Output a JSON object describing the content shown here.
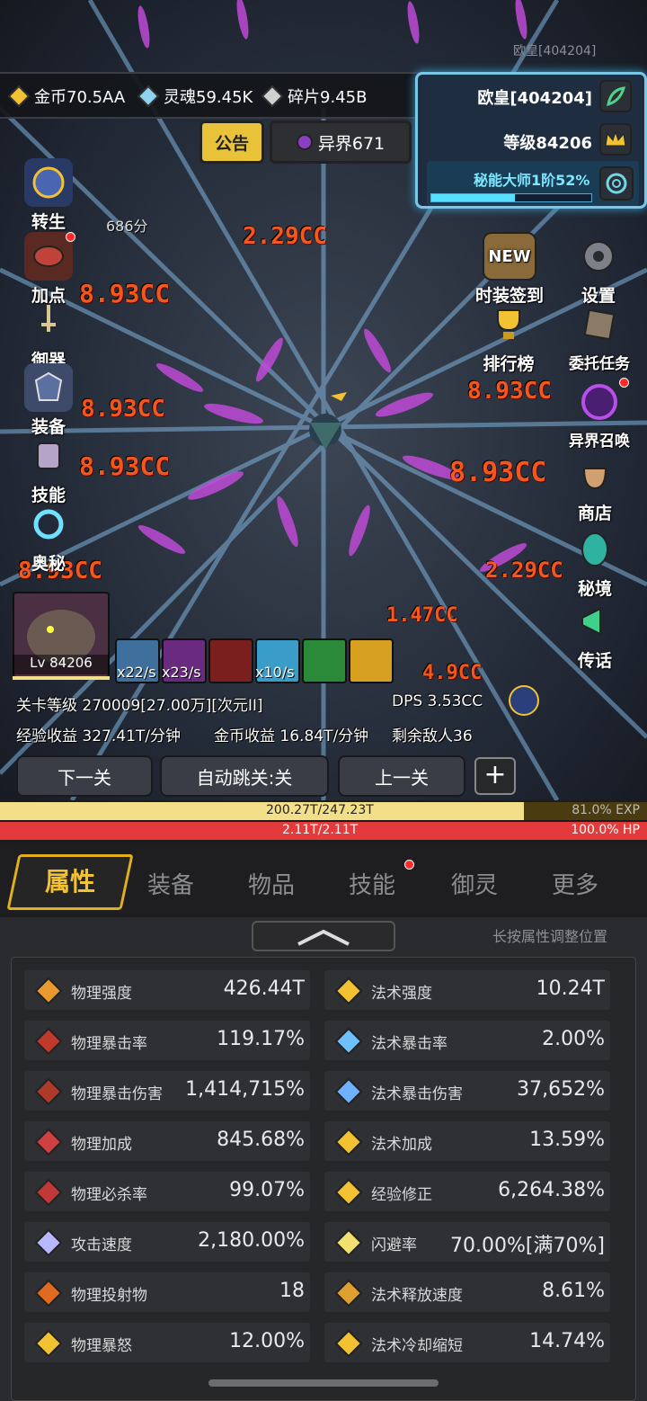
{
  "top_id": "欧皇[404204]",
  "resources": [
    {
      "icon": "gold-coin-icon",
      "label": "金币70.5AA"
    },
    {
      "icon": "soul-icon",
      "label": "灵魂59.45K"
    },
    {
      "icon": "shard-icon",
      "label": "碎片9.45B"
    }
  ],
  "player": {
    "name": "欧皇[404204]",
    "level": "等级84206",
    "mastery": "秘能大师1阶52%",
    "mastery_progress": 0.52
  },
  "notice": {
    "label": "公告"
  },
  "realm": {
    "label": "异界671"
  },
  "left_menu": [
    {
      "label": "转生",
      "icon": "rebirth-icon"
    },
    {
      "label": "加点",
      "icon": "meat-icon"
    },
    {
      "label": "御器",
      "icon": "sword-icon"
    },
    {
      "label": "装备",
      "icon": "armor-icon"
    },
    {
      "label": "技能",
      "icon": "scroll-icon"
    },
    {
      "label": "奥秘",
      "icon": "vortex-icon"
    }
  ],
  "right_menu": [
    {
      "label": "时装签到",
      "icon": "new-badge-icon"
    },
    {
      "label": "设置",
      "icon": "gear-icon"
    },
    {
      "label": "排行榜",
      "icon": "trophy-icon"
    },
    {
      "label": "委托任务",
      "icon": "quest-icon"
    },
    {
      "label": "异界召唤",
      "icon": "portal-icon"
    },
    {
      "label": "商店",
      "icon": "bag-icon"
    },
    {
      "label": "秘境",
      "icon": "secret-realm-icon"
    },
    {
      "label": "传话",
      "icon": "megaphone-icon"
    }
  ],
  "new_badge": "NEW",
  "timer": "686分",
  "damage_numbers": [
    "2.29CC",
    "8.93CC",
    "4.9CC",
    "1.47CC"
  ],
  "pet": {
    "level": "Lv 84206"
  },
  "skill_rates": [
    "x22/s",
    "x23/s",
    "x10/s"
  ],
  "stage": "关卡等级 270009[27.00万][次元II]",
  "dps": "DPS  3.53CC",
  "exp_income": "经验收益 327.41T/分钟",
  "gold_income": "金币收益 16.84T/分钟",
  "enemies": "剩余敌人36",
  "nav": {
    "next": "下一关",
    "auto": "自动跳关:关",
    "prev": "上一关",
    "plus": "+"
  },
  "exp_bar": {
    "text": "200.27T/247.23T",
    "pct": "81.0%  EXP",
    "fill": 0.81
  },
  "hp_bar": {
    "text": "2.11T/2.11T",
    "pct": "100.0%  HP",
    "fill": 1.0
  },
  "tabs": [
    "属性",
    "装备",
    "物品",
    "技能",
    "御灵",
    "更多"
  ],
  "hint": "长按属性调整位置",
  "attributes_left": [
    {
      "name": "物理强度",
      "value": "426.44T",
      "icon": "physical-power-icon"
    },
    {
      "name": "物理暴击率",
      "value": "119.17%",
      "icon": "physical-crit-icon"
    },
    {
      "name": "物理暴击伤害",
      "value": "1,414,715%",
      "icon": "physical-crit-damage-icon"
    },
    {
      "name": "物理加成",
      "value": "845.68%",
      "icon": "physical-bonus-icon"
    },
    {
      "name": "物理必杀率",
      "value": "99.07%",
      "icon": "physical-kill-icon"
    },
    {
      "name": "攻击速度",
      "value": "2,180.00%",
      "icon": "attack-speed-icon"
    },
    {
      "name": "物理投射物",
      "value": "18",
      "icon": "projectile-icon"
    },
    {
      "name": "物理暴怒",
      "value": "12.00%",
      "icon": "rage-icon"
    }
  ],
  "attributes_right": [
    {
      "name": "法术强度",
      "value": "10.24T",
      "icon": "spell-power-icon"
    },
    {
      "name": "法术暴击率",
      "value": "2.00%",
      "icon": "spell-crit-icon"
    },
    {
      "name": "法术暴击伤害",
      "value": "37,652%",
      "icon": "spell-crit-damage-icon"
    },
    {
      "name": "法术加成",
      "value": "13.59%",
      "icon": "spell-bonus-icon"
    },
    {
      "name": "经验修正",
      "value": "6,264.38%",
      "icon": "crown-icon"
    },
    {
      "name": "闪避率",
      "value": "70.00%[满70%]",
      "icon": "dodge-boot-icon"
    },
    {
      "name": "法术释放速度",
      "value": "8.61%",
      "icon": "cast-speed-icon"
    },
    {
      "name": "法术冷却缩短",
      "value": "14.74%",
      "icon": "cooldown-icon"
    }
  ],
  "colors": {
    "accent": "#f2c233",
    "exp": "#f3df8a",
    "hp": "#e33b3b",
    "damage": "#ff5a1a",
    "panel_border": "#7cc7e8"
  }
}
